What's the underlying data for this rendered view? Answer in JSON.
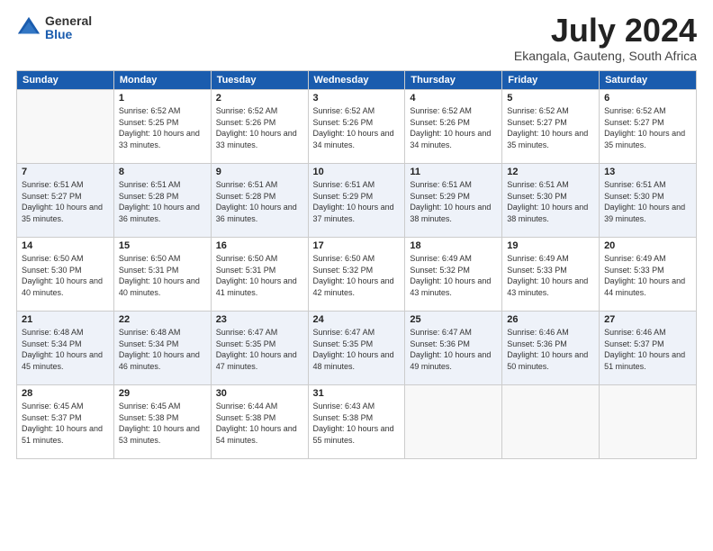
{
  "header": {
    "logo": {
      "general": "General",
      "blue": "Blue"
    },
    "title": "July 2024",
    "location": "Ekangala, Gauteng, South Africa"
  },
  "days_of_week": [
    "Sunday",
    "Monday",
    "Tuesday",
    "Wednesday",
    "Thursday",
    "Friday",
    "Saturday"
  ],
  "weeks": [
    [
      {
        "day": "",
        "sunrise": "",
        "sunset": "",
        "daylight": ""
      },
      {
        "day": "1",
        "sunrise": "Sunrise: 6:52 AM",
        "sunset": "Sunset: 5:25 PM",
        "daylight": "Daylight: 10 hours and 33 minutes."
      },
      {
        "day": "2",
        "sunrise": "Sunrise: 6:52 AM",
        "sunset": "Sunset: 5:26 PM",
        "daylight": "Daylight: 10 hours and 33 minutes."
      },
      {
        "day": "3",
        "sunrise": "Sunrise: 6:52 AM",
        "sunset": "Sunset: 5:26 PM",
        "daylight": "Daylight: 10 hours and 34 minutes."
      },
      {
        "day": "4",
        "sunrise": "Sunrise: 6:52 AM",
        "sunset": "Sunset: 5:26 PM",
        "daylight": "Daylight: 10 hours and 34 minutes."
      },
      {
        "day": "5",
        "sunrise": "Sunrise: 6:52 AM",
        "sunset": "Sunset: 5:27 PM",
        "daylight": "Daylight: 10 hours and 35 minutes."
      },
      {
        "day": "6",
        "sunrise": "Sunrise: 6:52 AM",
        "sunset": "Sunset: 5:27 PM",
        "daylight": "Daylight: 10 hours and 35 minutes."
      }
    ],
    [
      {
        "day": "7",
        "sunrise": "Sunrise: 6:51 AM",
        "sunset": "Sunset: 5:27 PM",
        "daylight": "Daylight: 10 hours and 35 minutes."
      },
      {
        "day": "8",
        "sunrise": "Sunrise: 6:51 AM",
        "sunset": "Sunset: 5:28 PM",
        "daylight": "Daylight: 10 hours and 36 minutes."
      },
      {
        "day": "9",
        "sunrise": "Sunrise: 6:51 AM",
        "sunset": "Sunset: 5:28 PM",
        "daylight": "Daylight: 10 hours and 36 minutes."
      },
      {
        "day": "10",
        "sunrise": "Sunrise: 6:51 AM",
        "sunset": "Sunset: 5:29 PM",
        "daylight": "Daylight: 10 hours and 37 minutes."
      },
      {
        "day": "11",
        "sunrise": "Sunrise: 6:51 AM",
        "sunset": "Sunset: 5:29 PM",
        "daylight": "Daylight: 10 hours and 38 minutes."
      },
      {
        "day": "12",
        "sunrise": "Sunrise: 6:51 AM",
        "sunset": "Sunset: 5:30 PM",
        "daylight": "Daylight: 10 hours and 38 minutes."
      },
      {
        "day": "13",
        "sunrise": "Sunrise: 6:51 AM",
        "sunset": "Sunset: 5:30 PM",
        "daylight": "Daylight: 10 hours and 39 minutes."
      }
    ],
    [
      {
        "day": "14",
        "sunrise": "Sunrise: 6:50 AM",
        "sunset": "Sunset: 5:30 PM",
        "daylight": "Daylight: 10 hours and 40 minutes."
      },
      {
        "day": "15",
        "sunrise": "Sunrise: 6:50 AM",
        "sunset": "Sunset: 5:31 PM",
        "daylight": "Daylight: 10 hours and 40 minutes."
      },
      {
        "day": "16",
        "sunrise": "Sunrise: 6:50 AM",
        "sunset": "Sunset: 5:31 PM",
        "daylight": "Daylight: 10 hours and 41 minutes."
      },
      {
        "day": "17",
        "sunrise": "Sunrise: 6:50 AM",
        "sunset": "Sunset: 5:32 PM",
        "daylight": "Daylight: 10 hours and 42 minutes."
      },
      {
        "day": "18",
        "sunrise": "Sunrise: 6:49 AM",
        "sunset": "Sunset: 5:32 PM",
        "daylight": "Daylight: 10 hours and 43 minutes."
      },
      {
        "day": "19",
        "sunrise": "Sunrise: 6:49 AM",
        "sunset": "Sunset: 5:33 PM",
        "daylight": "Daylight: 10 hours and 43 minutes."
      },
      {
        "day": "20",
        "sunrise": "Sunrise: 6:49 AM",
        "sunset": "Sunset: 5:33 PM",
        "daylight": "Daylight: 10 hours and 44 minutes."
      }
    ],
    [
      {
        "day": "21",
        "sunrise": "Sunrise: 6:48 AM",
        "sunset": "Sunset: 5:34 PM",
        "daylight": "Daylight: 10 hours and 45 minutes."
      },
      {
        "day": "22",
        "sunrise": "Sunrise: 6:48 AM",
        "sunset": "Sunset: 5:34 PM",
        "daylight": "Daylight: 10 hours and 46 minutes."
      },
      {
        "day": "23",
        "sunrise": "Sunrise: 6:47 AM",
        "sunset": "Sunset: 5:35 PM",
        "daylight": "Daylight: 10 hours and 47 minutes."
      },
      {
        "day": "24",
        "sunrise": "Sunrise: 6:47 AM",
        "sunset": "Sunset: 5:35 PM",
        "daylight": "Daylight: 10 hours and 48 minutes."
      },
      {
        "day": "25",
        "sunrise": "Sunrise: 6:47 AM",
        "sunset": "Sunset: 5:36 PM",
        "daylight": "Daylight: 10 hours and 49 minutes."
      },
      {
        "day": "26",
        "sunrise": "Sunrise: 6:46 AM",
        "sunset": "Sunset: 5:36 PM",
        "daylight": "Daylight: 10 hours and 50 minutes."
      },
      {
        "day": "27",
        "sunrise": "Sunrise: 6:46 AM",
        "sunset": "Sunset: 5:37 PM",
        "daylight": "Daylight: 10 hours and 51 minutes."
      }
    ],
    [
      {
        "day": "28",
        "sunrise": "Sunrise: 6:45 AM",
        "sunset": "Sunset: 5:37 PM",
        "daylight": "Daylight: 10 hours and 51 minutes."
      },
      {
        "day": "29",
        "sunrise": "Sunrise: 6:45 AM",
        "sunset": "Sunset: 5:38 PM",
        "daylight": "Daylight: 10 hours and 53 minutes."
      },
      {
        "day": "30",
        "sunrise": "Sunrise: 6:44 AM",
        "sunset": "Sunset: 5:38 PM",
        "daylight": "Daylight: 10 hours and 54 minutes."
      },
      {
        "day": "31",
        "sunrise": "Sunrise: 6:43 AM",
        "sunset": "Sunset: 5:38 PM",
        "daylight": "Daylight: 10 hours and 55 minutes."
      },
      {
        "day": "",
        "sunrise": "",
        "sunset": "",
        "daylight": ""
      },
      {
        "day": "",
        "sunrise": "",
        "sunset": "",
        "daylight": ""
      },
      {
        "day": "",
        "sunrise": "",
        "sunset": "",
        "daylight": ""
      }
    ]
  ]
}
